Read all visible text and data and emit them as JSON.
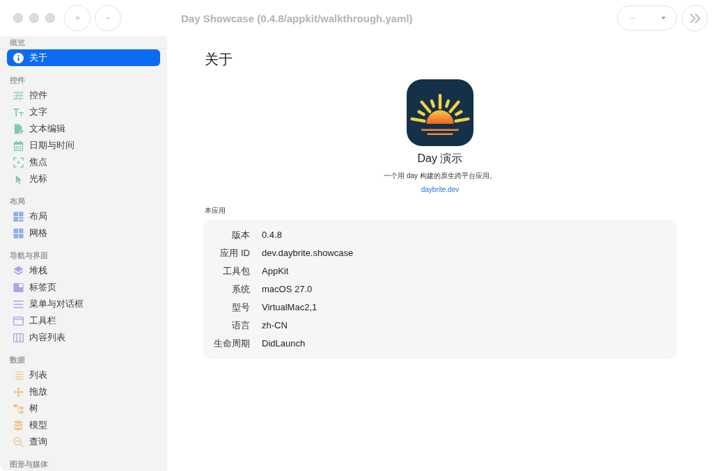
{
  "window": {
    "title": "Day Showcase (0.4.8/appkit/walkthrough.yaml)",
    "focused": false
  },
  "sidebar": {
    "sections": [
      {
        "title": "概览",
        "items": [
          {
            "label": "关于",
            "selected": true
          }
        ]
      },
      {
        "title": "控件",
        "color": "#7fcab6",
        "items": [
          {
            "label": "控件",
            "selected": false
          },
          {
            "label": "文字",
            "selected": false
          },
          {
            "label": "文本编辑",
            "selected": false
          },
          {
            "label": "日期与时间",
            "selected": false
          },
          {
            "label": "焦点",
            "selected": false
          },
          {
            "label": "光标",
            "selected": false
          }
        ]
      },
      {
        "title": "布局",
        "color": "#8eb0ea",
        "items": [
          {
            "label": "布局",
            "selected": false
          },
          {
            "label": "网格",
            "selected": false
          }
        ]
      },
      {
        "title": "导航与界面",
        "color": "#b4a2e8",
        "items": [
          {
            "label": "堆栈",
            "selected": false
          },
          {
            "label": "标签页",
            "selected": false
          },
          {
            "label": "菜单与对话框",
            "selected": false
          },
          {
            "label": "工具栏",
            "selected": false
          },
          {
            "label": "内容列表",
            "selected": false
          }
        ]
      },
      {
        "title": "数据",
        "color": "#f2c68e",
        "items": [
          {
            "label": "列表",
            "selected": false
          },
          {
            "label": "拖放",
            "selected": false
          },
          {
            "label": "树",
            "selected": false
          },
          {
            "label": "模型",
            "selected": false
          },
          {
            "label": "查询",
            "selected": false
          }
        ]
      },
      {
        "title": "图形与媒体"
      }
    ]
  },
  "page": {
    "title": "关于",
    "app_name": "Day 演示",
    "description": "一个用 day 构建的原生跨平台应用。",
    "link": "daybrite.dev",
    "section_label": "本应用",
    "info": [
      {
        "label": "版本",
        "value": "0.4.8"
      },
      {
        "label": "应用 ID",
        "value": "dev.daybrite.showcase"
      },
      {
        "label": "工具包",
        "value": "AppKit"
      },
      {
        "label": "系统",
        "value": "macOS 27.0"
      },
      {
        "label": "型号",
        "value": "VirtualMac2,1"
      },
      {
        "label": "语言",
        "value": "zh-CN"
      },
      {
        "label": "生命周期",
        "value": "DidLaunch"
      }
    ]
  }
}
